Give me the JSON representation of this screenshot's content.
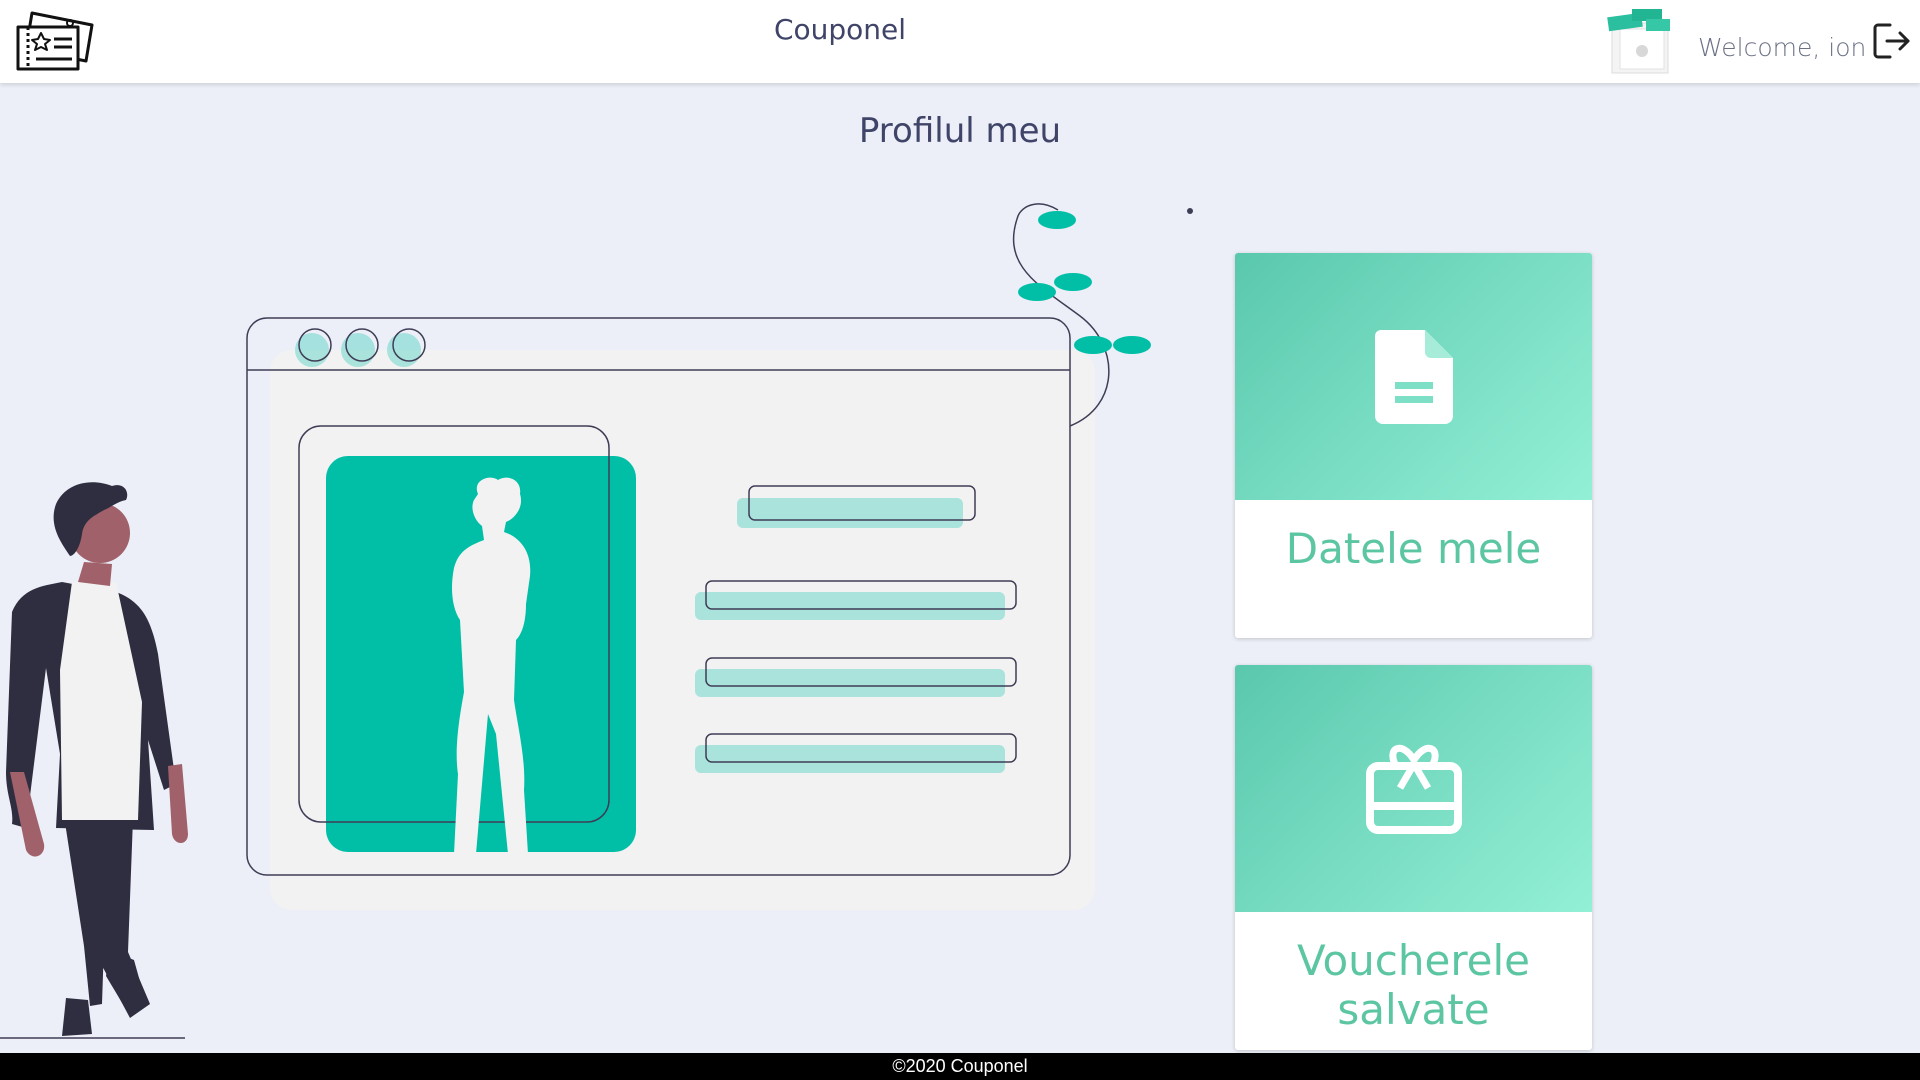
{
  "header": {
    "app_title": "Couponel",
    "welcome_text": "Welcome, ion",
    "logo_icon": "coupon-logo-icon",
    "avatar_icon": "vouchers-avatar-icon",
    "logout_icon": "logout-icon"
  },
  "main": {
    "page_title": "Profilul meu",
    "illustration": "profile-illustration"
  },
  "cards": [
    {
      "label": "Datele mele",
      "icon": "document-icon"
    },
    {
      "label": "Voucherele salvate",
      "icon": "gift-card-icon"
    }
  ],
  "footer": {
    "copyright": "©2020 Couponel"
  },
  "colors": {
    "accent": "#5cc6a3",
    "teal": "#00bfa6",
    "background": "#eceff7",
    "dark": "#3f3d56"
  }
}
